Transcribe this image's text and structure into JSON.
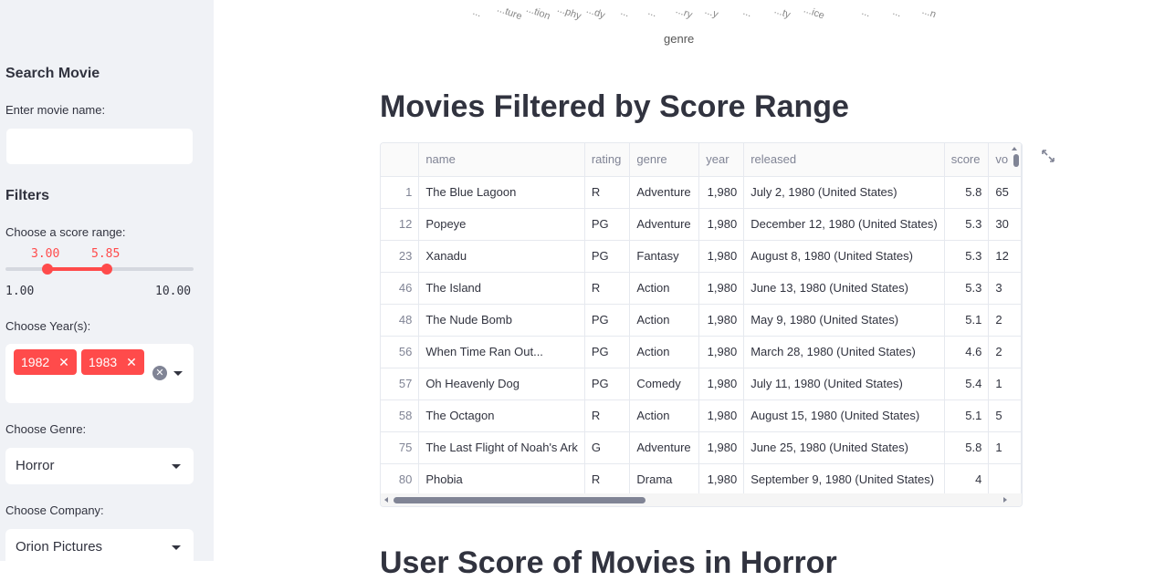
{
  "sidebar": {
    "search_title": "Search Movie",
    "movie_name_label": "Enter movie name:",
    "movie_name_value": "",
    "filters_title": "Filters",
    "score_label": "Choose a score range:",
    "score_range": {
      "low": "3.00",
      "high": "5.85",
      "min": "1.00",
      "max": "10.00",
      "low_value": 3.0,
      "high_value": 5.85,
      "min_value": 1.0,
      "max_value": 10.0
    },
    "year_label": "Choose Year(s):",
    "years": [
      "1982",
      "1983"
    ],
    "genre_label": "Choose Genre:",
    "genre_value": "Horror",
    "company_label": "Choose Company:",
    "company_value": "Orion Pictures"
  },
  "chart_top": {
    "tick_labels": [
      "...",
      "...ture",
      "...tion",
      "...phy",
      "...dy",
      "...",
      "...",
      "...ry",
      "...y",
      "...",
      "...ty",
      "...ice",
      "...",
      "...",
      "...n"
    ],
    "axis_title": "genre"
  },
  "main": {
    "section_title": "Movies Filtered by Score Range",
    "next_section_title": "User Score of Movies in Horror"
  },
  "table": {
    "columns": [
      "",
      "name",
      "rating",
      "genre",
      "year",
      "released",
      "score",
      "vo"
    ],
    "rows": [
      [
        "1",
        "The Blue Lagoon",
        "R",
        "Adventure",
        "1,980",
        "July 2, 1980 (United States)",
        "5.8",
        "65"
      ],
      [
        "12",
        "Popeye",
        "PG",
        "Adventure",
        "1,980",
        "December 12, 1980 (United States)",
        "5.3",
        "30"
      ],
      [
        "23",
        "Xanadu",
        "PG",
        "Fantasy",
        "1,980",
        "August 8, 1980 (United States)",
        "5.3",
        "12"
      ],
      [
        "46",
        "The Island",
        "R",
        "Action",
        "1,980",
        "June 13, 1980 (United States)",
        "5.3",
        "3"
      ],
      [
        "48",
        "The Nude Bomb",
        "PG",
        "Action",
        "1,980",
        "May 9, 1980 (United States)",
        "5.1",
        "2"
      ],
      [
        "56",
        "When Time Ran Out...",
        "PG",
        "Action",
        "1,980",
        "March 28, 1980 (United States)",
        "4.6",
        "2"
      ],
      [
        "57",
        "Oh Heavenly Dog",
        "PG",
        "Comedy",
        "1,980",
        "July 11, 1980 (United States)",
        "5.4",
        "1"
      ],
      [
        "58",
        "The Octagon",
        "R",
        "Action",
        "1,980",
        "August 15, 1980 (United States)",
        "5.1",
        "5"
      ],
      [
        "75",
        "The Last Flight of Noah's Ark",
        "G",
        "Adventure",
        "1,980",
        "June 25, 1980 (United States)",
        "5.8",
        "1"
      ],
      [
        "80",
        "Phobia",
        "R",
        "Drama",
        "1,980",
        "September 9, 1980 (United States)",
        "4",
        ""
      ]
    ]
  },
  "colors": {
    "accent": "#ff4b4b",
    "sidebar_bg": "#f0f2f6",
    "text": "#31333f"
  }
}
